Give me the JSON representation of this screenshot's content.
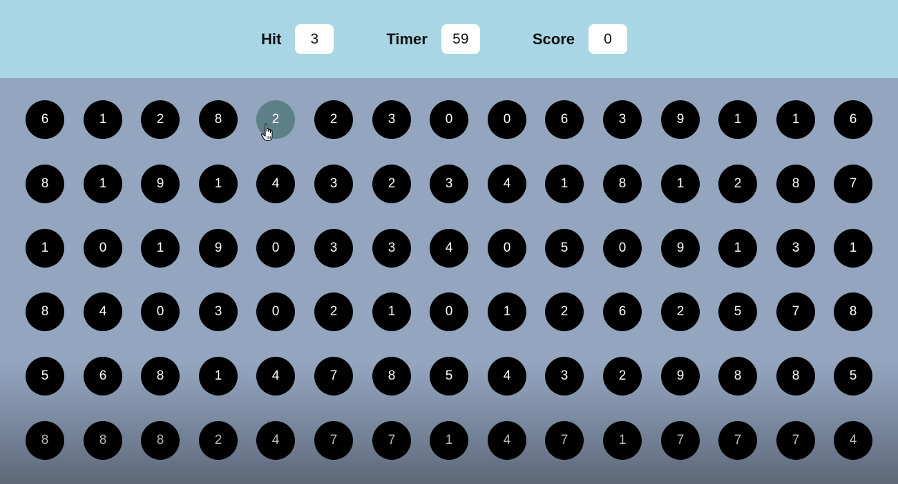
{
  "stats": {
    "hit": {
      "label": "Hit",
      "value": "3"
    },
    "timer": {
      "label": "Timer",
      "value": "59"
    },
    "score": {
      "label": "Score",
      "value": "0"
    }
  },
  "board": {
    "rows": [
      [
        "6",
        "1",
        "2",
        "8",
        "2",
        "2",
        "3",
        "0",
        "0",
        "6",
        "3",
        "9",
        "1",
        "1",
        "6"
      ],
      [
        "8",
        "1",
        "9",
        "1",
        "4",
        "3",
        "2",
        "3",
        "4",
        "1",
        "8",
        "1",
        "2",
        "8",
        "7"
      ],
      [
        "1",
        "0",
        "1",
        "9",
        "0",
        "3",
        "3",
        "4",
        "0",
        "5",
        "0",
        "9",
        "1",
        "3",
        "1"
      ],
      [
        "8",
        "4",
        "0",
        "3",
        "0",
        "2",
        "1",
        "0",
        "1",
        "2",
        "6",
        "2",
        "5",
        "7",
        "8"
      ],
      [
        "5",
        "6",
        "8",
        "1",
        "4",
        "7",
        "8",
        "5",
        "4",
        "3",
        "2",
        "9",
        "8",
        "8",
        "5"
      ],
      [
        "8",
        "8",
        "8",
        "2",
        "4",
        "7",
        "7",
        "1",
        "4",
        "7",
        "1",
        "7",
        "7",
        "7",
        "4"
      ]
    ],
    "hovered_bubble": {
      "row": 0,
      "col": 4
    }
  },
  "colors": {
    "header_bg": "#a9d6e5",
    "board_bg": "#94a5bf",
    "bubble": "#000000",
    "bubble_hover": "#5d8088"
  },
  "icons": {
    "cursor": "hand-pointer-cursor-icon"
  }
}
